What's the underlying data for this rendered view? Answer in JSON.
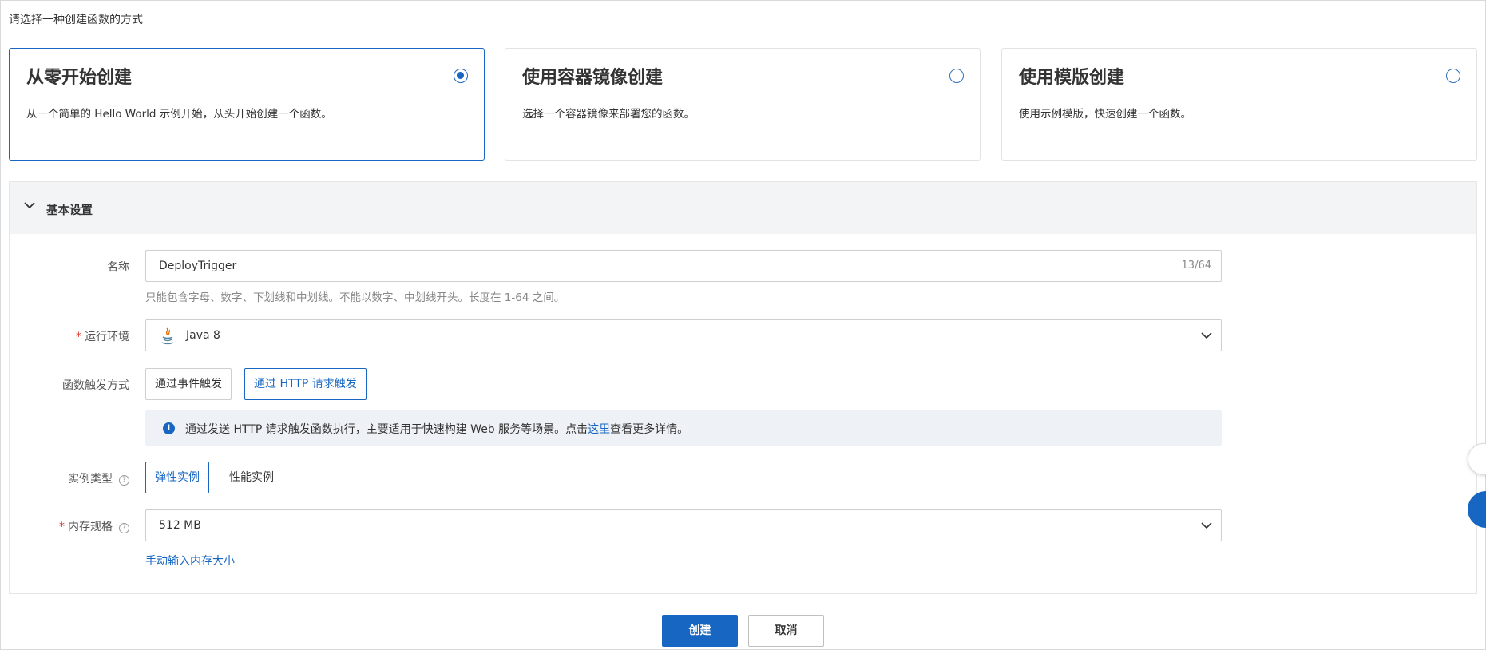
{
  "page": {
    "heading": "请选择一种创建函数的方式"
  },
  "methods": [
    {
      "title": "从零开始创建",
      "desc": "从一个简单的 Hello World 示例开始，从头开始创建一个函数。",
      "selected": true
    },
    {
      "title": "使用容器镜像创建",
      "desc": "选择一个容器镜像来部署您的函数。",
      "selected": false
    },
    {
      "title": "使用模版创建",
      "desc": "使用示例模版，快速创建一个函数。",
      "selected": false
    }
  ],
  "basic_settings": {
    "header": "基本设置",
    "name": {
      "label": "名称",
      "value": "DeployTrigger",
      "counter": "13/64",
      "hint": "只能包含字母、数字、下划线和中划线。不能以数字、中划线开头。长度在 1-64 之间。"
    },
    "runtime": {
      "required_mark": "*",
      "label": "运行环境",
      "value": "Java 8",
      "icon": "java-icon"
    },
    "trigger": {
      "label": "函数触发方式",
      "options": [
        "通过事件触发",
        "通过 HTTP 请求触发"
      ],
      "selected": "通过 HTTP 请求触发",
      "info_prefix": "通过发送 HTTP 请求触发函数执行，主要适用于快速构建 Web 服务等场景。点击",
      "info_link": "这里",
      "info_suffix": "查看更多详情。"
    },
    "instance_type": {
      "label": "实例类型",
      "help": "?",
      "options": [
        "弹性实例",
        "性能实例"
      ],
      "selected": "弹性实例"
    },
    "memory": {
      "required_mark": "*",
      "label": "内存规格",
      "help": "?",
      "value": "512 MB",
      "manual_link": "手动输入内存大小"
    }
  },
  "footer": {
    "create_label": "创建",
    "cancel_label": "取消"
  },
  "colors": {
    "accent": "#1766c2",
    "required": "#d93026",
    "panel_header_bg": "#f2f4f6",
    "info_bg": "#eef1f6"
  }
}
